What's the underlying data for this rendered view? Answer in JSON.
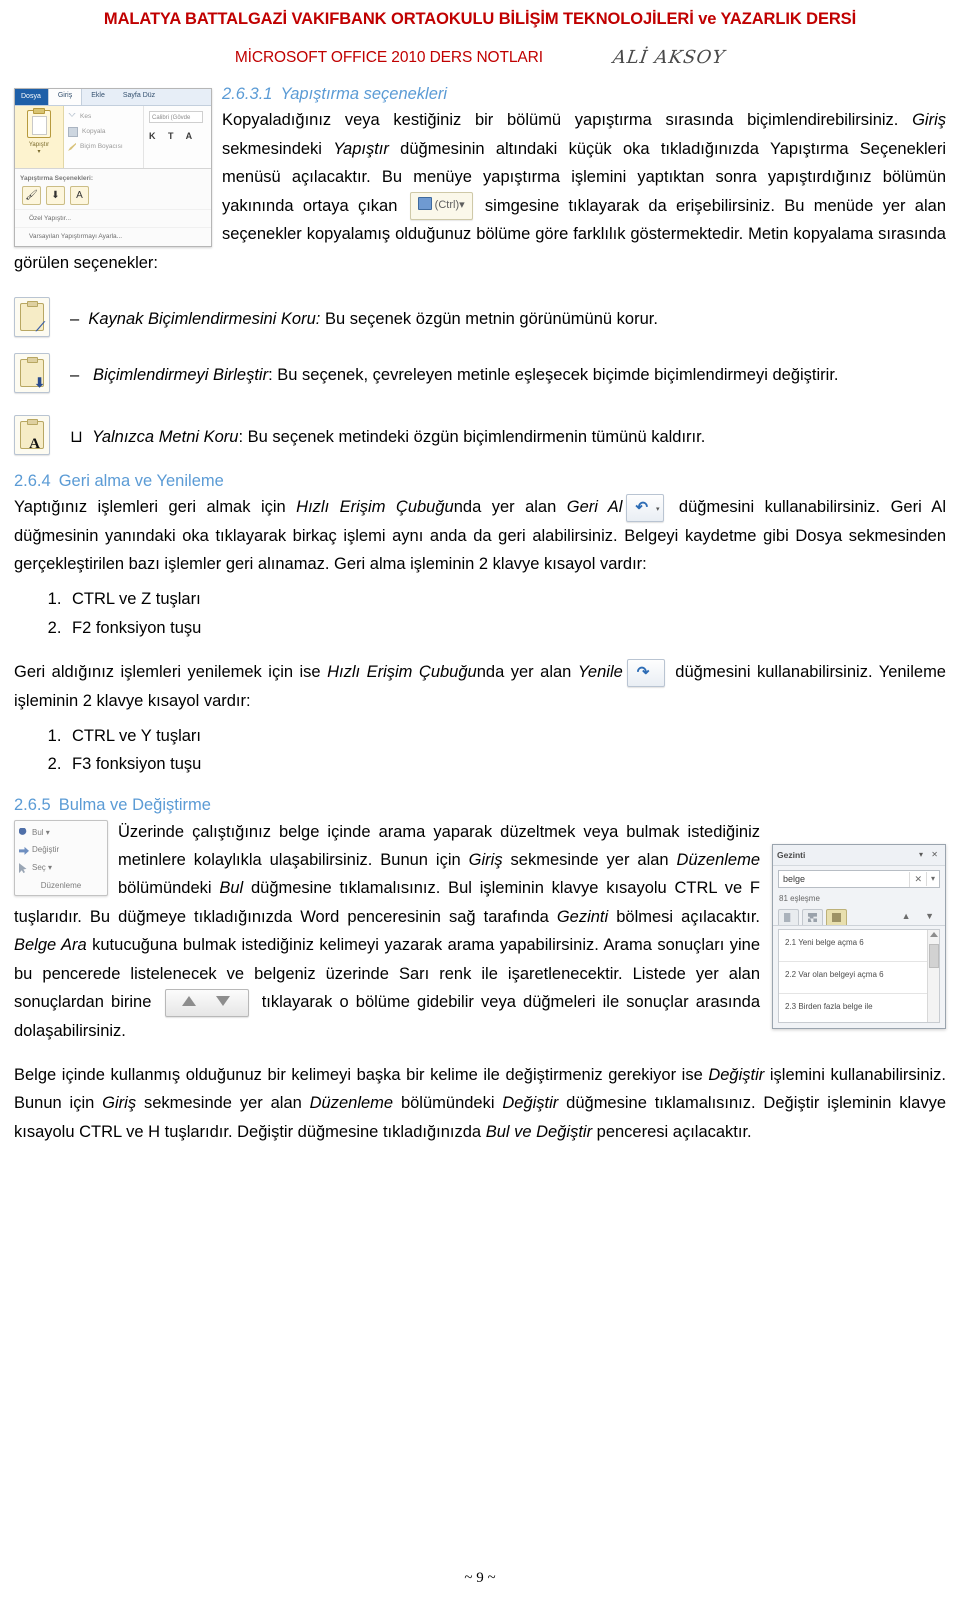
{
  "header": {
    "line1": "MALATYA BATTALGAZİ VAKIFBANK ORTAOKULU BİLİŞİM TEKNOLOJİLERİ ve YAZARLIK DERSİ",
    "line2": "MİCROSOFT OFFICE 2010 DERS NOTLARI",
    "signature": "ALİ AKSOY"
  },
  "sections": {
    "s2631": {
      "number": "2.6.3.1",
      "title": "Yapıştırma seçenekleri",
      "p1_a": "Kopyaladığınız veya kestiğiniz bir bölümü yapıştırma sırasında biçimlendirebilirsiniz. ",
      "p1_giris": "Giriş",
      "p1_b": " sekmesindeki ",
      "p1_yapistir": "Yapıştır",
      "p1_c": " düğmesinin altındaki küçük oka tıkladığınızda Yapıştırma Seçenekleri menüsü açılacaktır. Bu menüye yapıştırma işlemini yaptıktan sonra yapıştırdığınız bölümün yakınında ortaya çıkan ",
      "p1_d": " simgesine tıklayarak da erişebilirsiniz. Bu menüde yer alan seçenekler kopyalamış olduğunuz bölüme göre farklılık göstermektedir. Metin kopyalama sırasında görülen seçenekler:",
      "options": [
        {
          "bullet": "–",
          "name": "Kaynak Biçimlendirmesini Koru:",
          "desc": " Bu seçenek özgün metnin görünümünü korur.",
          "icon": "paste-keep-source-formatting-icon"
        },
        {
          "bullet": "–",
          "name": "Biçimlendirmeyi Birleştir",
          "desc": ": Bu seçenek, çevreleyen metinle eşleşecek biçimde biçimlendirmeyi değiştirir.",
          "icon": "paste-merge-formatting-icon"
        },
        {
          "bullet": "⊔",
          "name": "Yalnızca Metni Koru",
          "desc": ": Bu seçenek metindeki özgün biçimlendirmenin tümünü kaldırır.",
          "icon": "paste-keep-text-only-icon"
        }
      ]
    },
    "s264": {
      "number": "2.6.4",
      "title": "Geri alma ve Yenileme",
      "p1_a": "Yaptığınız işlemleri geri almak için ",
      "p1_qat": "Hızlı Erişim Çubuğu",
      "p1_b": "nda yer alan ",
      "p1_gerial": "Geri Al",
      "p1_c": " düğmesini kullanabilirsiniz. Geri Al düğmesinin yanındaki oka tıklayarak birkaç işlemi aynı anda da geri alabilirsiniz. Belgeyi kaydetme gibi Dosya sekmesinden gerçekleştirilen bazı işlemler geri alınamaz. Geri alma işleminin 2 klavye kısayol vardır:",
      "undo_shortcuts": [
        "CTRL ve Z tuşları",
        "F2 fonksiyon tuşu"
      ],
      "p2_a": "Geri aldığınız işlemleri yenilemek için ise ",
      "p2_qat": "Hızlı Erişim Çubuğu",
      "p2_b": "nda yer alan ",
      "p2_yenile": "Yenile",
      "p2_c": " düğmesini kullanabilirsiniz. Yenileme işleminin 2 klavye kısayol vardır:",
      "redo_shortcuts": [
        "CTRL ve Y tuşları",
        "F3 fonksiyon tuşu"
      ]
    },
    "s265": {
      "number": "2.6.5",
      "title": "Bulma ve Değiştirme",
      "p1_a": "Üzerinde çalıştığınız belge içinde arama yaparak düzeltmek veya bulmak istediğiniz metinlere kolaylıkla ulaşabilirsiniz. Bunun için ",
      "p1_giris": "Giriş",
      "p1_b": " sekmesinde yer alan ",
      "p1_duzenleme": "Düzenleme",
      "p1_c": " bölümündeki ",
      "p1_bul": "Bul",
      "p1_d": " düğmesine tıklamalısınız. Bul işleminin klavye kısayolu CTRL ve F tuşlarıdır. Bu düğmeye tıkladığınızda Word penceresinin sağ tarafında ",
      "p1_gezinti": "Gezinti",
      "p1_e": " bölmesi açılacaktır. ",
      "p1_belgeara": "Belge Ara",
      "p1_f": " kutucuğuna bulmak istediğiniz kelimeyi yazarak arama yapabilirsiniz. Arama sonuçları yine bu pencerede listelenecek ve belgeniz üzerinde Sarı renk ile işaretlenecektir. Listede yer alan sonuçlardan birine ",
      "p1_g": " tıklayarak o bölüme gidebilir veya düğmeleri ile sonuçlar arasında dolaşabilirsiniz.",
      "p2_a": "Belge içinde kullanmış olduğunuz bir kelimeyi başka bir kelime ile değiştirmeniz gerekiyor ise ",
      "p2_degistir1": "Değiştir",
      "p2_b": " işlemini kullanabilirsiniz. Bunun için ",
      "p2_giris": "Giriş",
      "p2_c": " sekmesinde yer alan ",
      "p2_duzenleme": "Düzenleme",
      "p2_d": " bölümündeki ",
      "p2_degistir2": "Değiştir",
      "p2_e": " düğmesine tıklamalısınız.   Değiştir işleminin klavye kısayolu CTRL ve H tuşlarıdır. Değiştir düğmesine tıkladığınızda ",
      "p2_buldegistir": "Bul ve Değiştir",
      "p2_f": " penceresi açılacaktır."
    }
  },
  "ribbon_image": {
    "tab_file": "Dosya",
    "tabs": [
      "Giriş",
      "Ekle",
      "Sayfa Düz"
    ],
    "paste_label": "Yapıştır",
    "clipboard_cmds": [
      "Kes",
      "Kopyala",
      "Biçim Boyacısı"
    ],
    "font_box": "Calibri (Gövde",
    "font_buttons": "K T A",
    "menu_title": "Yapıştırma Seçenekleri:",
    "menu_items": [
      "Özel Yapıştır...",
      "Varsayılan Yapıştırmayı Ayarla..."
    ]
  },
  "ctrl_tag": {
    "label": "(Ctrl)",
    "caret": "▾"
  },
  "editing_group_image": {
    "items": [
      "Bul ▾",
      "Değiştir",
      "Seç ▾"
    ],
    "caption": "Düzenleme"
  },
  "navigation_pane": {
    "title": "Gezinti",
    "search_value": "belge",
    "match_count": "81 eşleşme",
    "results": [
      "2.1 Yeni belge açma 6",
      "2.2 Var olan belgeyi açma 6",
      "2.3 Birden fazla belge ile"
    ]
  },
  "footer": {
    "page": "~ 9 ~"
  },
  "colors": {
    "heading": "#5b9bd5",
    "header_red": "#c00000",
    "body": "#000000"
  }
}
